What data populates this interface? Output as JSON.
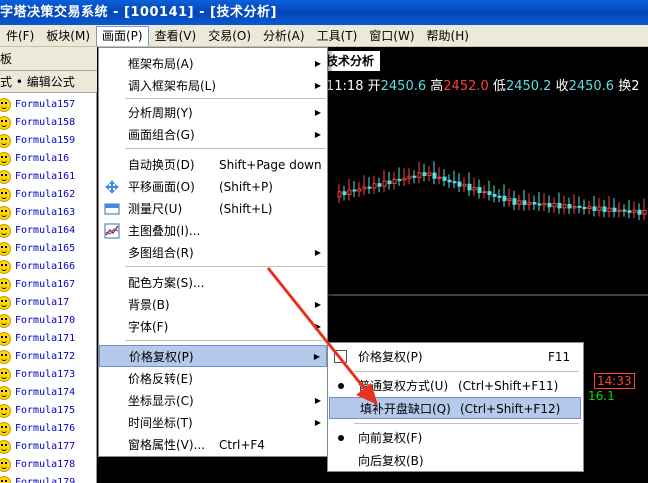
{
  "titlebar": {
    "title": "字塔决策交易系统 - [100141] - [技术分析]"
  },
  "menubar": [
    "件(F)",
    "板块(M)",
    "画面(P)",
    "查看(V)",
    "交易(O)",
    "分析(A)",
    "工具(T)",
    "窗口(W)",
    "帮助(H)"
  ],
  "leftpanel": {
    "tab": "板",
    "toolbar": "式 • 编辑公式",
    "formulas": [
      "Formula157",
      "Formula158",
      "Formula159",
      "Formula16",
      "Formula161",
      "Formula162",
      "Formula163",
      "Formula164",
      "Formula165",
      "Formula166",
      "Formula167",
      "Formula17",
      "Formula170",
      "Formula171",
      "Formula172",
      "Formula173",
      "Formula174",
      "Formula175",
      "Formula176",
      "Formula177",
      "Formula178",
      "Formula179"
    ]
  },
  "chart": {
    "tab": "技术分析",
    "quote": {
      "time": "11:18",
      "open_label": "开",
      "open": "2450.6",
      "high_label": "高",
      "high": "2452.0",
      "low_label": "低",
      "low": "2450.2",
      "close_label": "收",
      "close": "2450.6",
      "turnover_label": "换2"
    },
    "side_time": "14:33",
    "side_value": "16.1"
  },
  "menu": {
    "items": [
      {
        "label": "框架布局(A)",
        "sub": true
      },
      {
        "label": "调入框架布局(L)",
        "sub": true
      },
      {
        "label": "分析周期(Y)",
        "sub": true
      },
      {
        "label": "画面组合(G)",
        "sub": true
      },
      {
        "label": "自动换页(D)",
        "shortcut": "Shift+Page down"
      },
      {
        "label": "平移画面(O)",
        "shortcut": "(Shift+P)",
        "icon": "move-icon"
      },
      {
        "label": "测量尺(U)",
        "shortcut": "(Shift+L)",
        "icon": "ruler-icon"
      },
      {
        "label": "主图叠加(I)...",
        "icon": "overlay-chart-icon"
      },
      {
        "label": "多图组合(R)",
        "sub": true
      },
      {
        "label": "配色方案(S)..."
      },
      {
        "label": "背景(B)",
        "sub": true
      },
      {
        "label": "字体(F)",
        "sub": true
      },
      {
        "label": "价格复权(P)",
        "sub": true
      },
      {
        "label": "价格反转(E)"
      },
      {
        "label": "坐标显示(C)",
        "sub": true
      },
      {
        "label": "时间坐标(T)",
        "sub": true
      },
      {
        "label": "窗格属性(V)...",
        "shortcut": "Ctrl+F4"
      }
    ]
  },
  "submenu": {
    "items": [
      {
        "label": "价格复权(P)",
        "shortcut": "F11"
      },
      {
        "label": "普通复权方式(U)",
        "shortcut": "(Ctrl+Shift+F11)",
        "checked": true
      },
      {
        "label": "填补开盘缺口(Q)",
        "shortcut": "(Ctrl+Shift+F12)"
      },
      {
        "label": "向前复权(F)",
        "checked": true
      },
      {
        "label": "向后复权(B)"
      }
    ]
  },
  "colors": {
    "title_bar": "#0a58d0",
    "menu_highlight": "#b5c9ea",
    "annotation_arrow": "#e8321e",
    "candle_up": "#ff4040",
    "candle_down": "#58e0e0"
  }
}
